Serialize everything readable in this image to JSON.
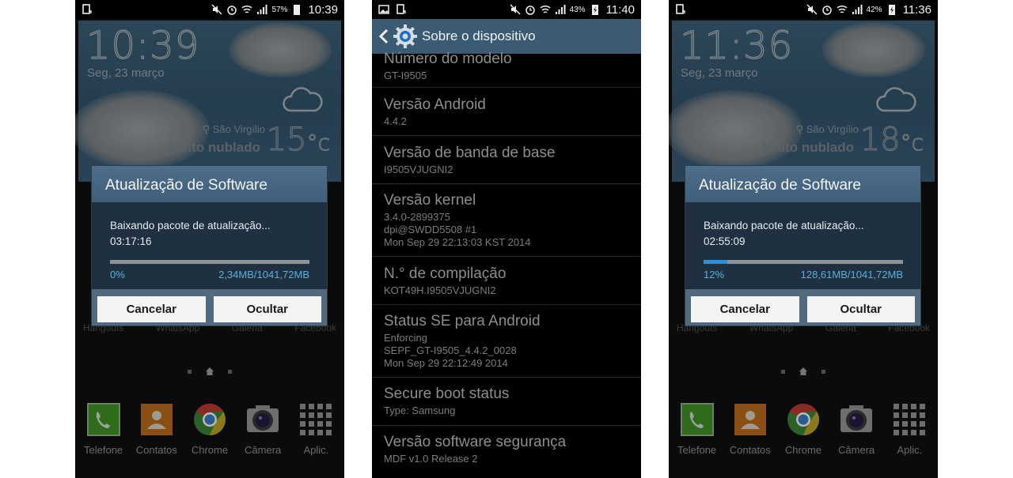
{
  "screens": [
    {
      "type": "home",
      "status_bar": {
        "battery_percent": "57%",
        "time": "10:39"
      },
      "clock": "10:39",
      "date": "Seg, 23 março",
      "weather": {
        "location": "São Virgílio",
        "condition": "Muito nublado",
        "temperature": "15",
        "unit": "°c"
      },
      "background_app_labels": [
        "Hangouts",
        "WhatsApp",
        "Galeria",
        "Facebook"
      ],
      "dialog": {
        "title": "Atualização de Software",
        "message": "Baixando pacote de atualização...",
        "time_remaining": "03:17:16",
        "progress_percent_label": "0%",
        "progress_fraction": 0.0,
        "size_label": "2,34MB/1041,72MB",
        "cancel_label": "Cancelar",
        "hide_label": "Ocultar"
      },
      "dock": [
        {
          "label": "Telefone",
          "icon": "phone-icon"
        },
        {
          "label": "Contatos",
          "icon": "contacts-icon"
        },
        {
          "label": "Chrome",
          "icon": "chrome-icon"
        },
        {
          "label": "Câmera",
          "icon": "camera-icon"
        },
        {
          "label": "Aplic.",
          "icon": "apps-grid-icon"
        }
      ]
    },
    {
      "type": "settings",
      "status_bar": {
        "battery_percent": "43%",
        "time": "11:40"
      },
      "header_title": "Sobre o dispositivo",
      "items": [
        {
          "title": "Número do modelo",
          "lines": [
            "GT-I9505"
          ]
        },
        {
          "title": "Versão Android",
          "lines": [
            "4.4.2"
          ]
        },
        {
          "title": "Versão de banda de base",
          "lines": [
            "I9505VJUGNI2"
          ]
        },
        {
          "title": "Versão kernel",
          "lines": [
            "3.4.0-2899375",
            "dpi@SWDD5508 #1",
            "Mon Sep 29 22:13:03 KST 2014"
          ]
        },
        {
          "title": "N.° de compilação",
          "lines": [
            "KOT49H.I9505VJUGNI2"
          ]
        },
        {
          "title": "Status SE para Android",
          "lines": [
            "Enforcing",
            "SEPF_GT-I9505_4.4.2_0028",
            "Mon Sep 29 22:12:49 2014"
          ]
        },
        {
          "title": "Secure boot status",
          "lines": [
            "Type: Samsung"
          ]
        },
        {
          "title": "Versão software segurança",
          "lines": [
            "MDF v1.0 Release 2"
          ]
        }
      ]
    },
    {
      "type": "home",
      "status_bar": {
        "battery_percent": "42%",
        "time": "11:36"
      },
      "clock": "11:36",
      "date": "Seg, 23 março",
      "weather": {
        "location": "São Virgílio",
        "condition": "Muito nublado",
        "temperature": "18",
        "unit": "°c"
      },
      "background_app_labels": [
        "Hangouts",
        "WhatsApp",
        "Galeria",
        "Facebook"
      ],
      "dialog": {
        "title": "Atualização de Software",
        "message": "Baixando pacote de atualização...",
        "time_remaining": "02:55:09",
        "progress_percent_label": "12%",
        "progress_fraction": 0.12,
        "size_label": "128,61MB/1041,72MB",
        "cancel_label": "Cancelar",
        "hide_label": "Ocultar"
      },
      "dock": [
        {
          "label": "Telefone",
          "icon": "phone-icon"
        },
        {
          "label": "Contatos",
          "icon": "contacts-icon"
        },
        {
          "label": "Chrome",
          "icon": "chrome-icon"
        },
        {
          "label": "Câmera",
          "icon": "camera-icon"
        },
        {
          "label": "Aplic.",
          "icon": "apps-grid-icon"
        }
      ]
    }
  ],
  "colors": {
    "dialog_title_bg": "#46657f",
    "dialog_body_bg": "#1f3141",
    "progress_fill": "#2f8fd1",
    "progress_text": "#5aaedb",
    "settings_header_bg": "#3b5a74"
  }
}
